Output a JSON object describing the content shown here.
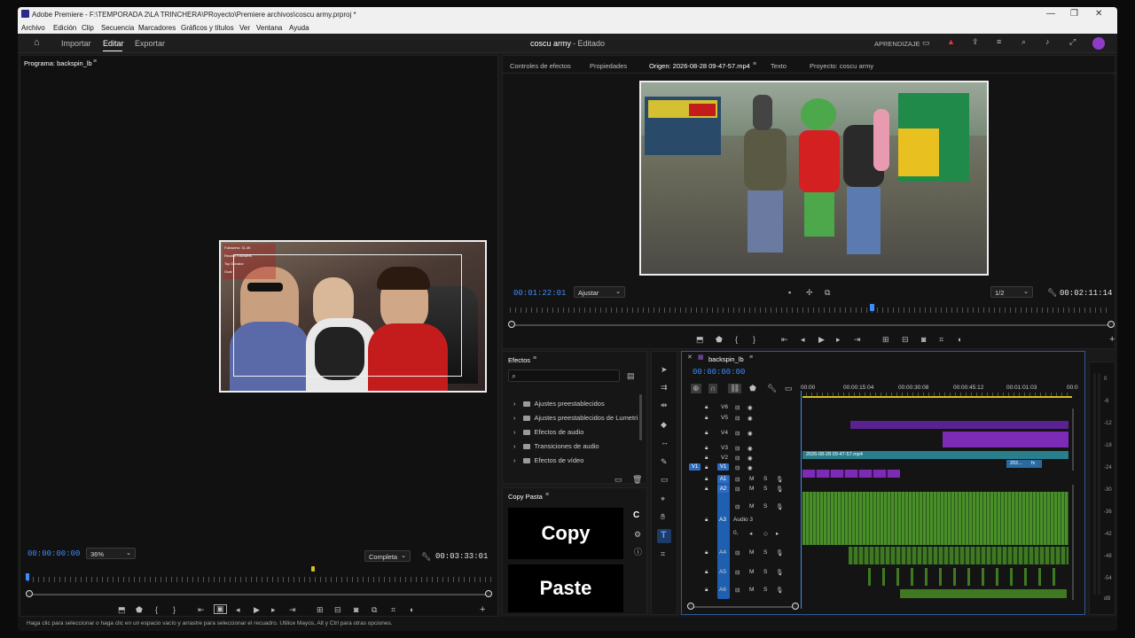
{
  "window": {
    "title": "Adobe Premiere - F:\\TEMPORADA 2\\LA TRINCHERA\\PRoyecto\\Premiere archivos\\coscu army.prproj *",
    "minimize": "—",
    "maximize": "❐",
    "close": "✕"
  },
  "menu": [
    "Archivo",
    "Edición",
    "Clip",
    "Secuencia",
    "Marcadores",
    "Gráficos y títulos",
    "Ver",
    "Ventana",
    "Ayuda"
  ],
  "header": {
    "home_icon": "home-icon",
    "workspaces": [
      "Importar",
      "Editar",
      "Exportar"
    ],
    "active_workspace": "Editar",
    "project_title": "coscu army",
    "project_state": "- Editado",
    "learn": "APRENDIZAJE"
  },
  "program_monitor": {
    "tab": "Programa: backspin_lb",
    "timecode": "00:00:00:00",
    "zoom": "36%",
    "quality": "Completa",
    "duration": "00:03:33:01"
  },
  "source_panel": {
    "tabs": [
      "Controles de efectos",
      "Propiedades",
      "Origen: 2026-08-28 09-47-57.mp4",
      "Texto",
      "Proyecto: coscu army"
    ],
    "active_tab": "Origen: 2026-08-28 09-47-57.mp4",
    "timecode": "00:01:22:01",
    "fit": "Ajustar",
    "resolution": "1/2",
    "duration": "00:02:11:14",
    "playhead_fraction": 0.6
  },
  "effects": {
    "tab": "Efectos",
    "items": [
      "Ajustes preestablecidos",
      "Ajustes preestablecidos de Lumetri",
      "Efectos de audio",
      "Transiciones de audio",
      "Efectos de vídeo"
    ]
  },
  "copypasta": {
    "tab": "Copy Pasta",
    "copy": "Copy",
    "paste": "Paste"
  },
  "timeline": {
    "tab": "backspin_lb",
    "timecode": "00:00:00:00",
    "ruler": [
      "00:00",
      "00:00:15:04",
      "00:00:30:08",
      "00:00:45:12",
      "00:01:01:03",
      "00:0"
    ],
    "clip_name": "2026-08-28 09-47-57.mp4",
    "clip_short": "202...",
    "fx": "fx",
    "video_tracks": [
      "V6",
      "V5",
      "V4",
      "V3",
      "V2",
      "V1"
    ],
    "audio_tracks": [
      "A1",
      "A2",
      "A3",
      "A4",
      "A5",
      "A6"
    ],
    "audio3_name": "Audio 3",
    "mute": "M",
    "solo": "S",
    "volume_value": "0,"
  },
  "meter_labels": [
    "0",
    "-6",
    "-12",
    "-18",
    "-24",
    "-30",
    "-36",
    "-42",
    "-48",
    "-54",
    "dB"
  ],
  "webcam_overlay": {
    "line1": "Followers: 31.4K",
    "line2": "Recent Followers",
    "line3": "Top Donator",
    "line4": "Goal"
  },
  "status": "Haga clic para seleccionar o haga clic en un espacio vacío y arrastre para seleccionar el recuadro. Utilice Mayús, Alt y Ctrl para otras opciones.",
  "colors": {
    "accent": "#3d8bfd",
    "video_clip": "#7b2bb5",
    "audio_clip": "#4a8f2a",
    "teal_clip": "#2a7f8c"
  }
}
